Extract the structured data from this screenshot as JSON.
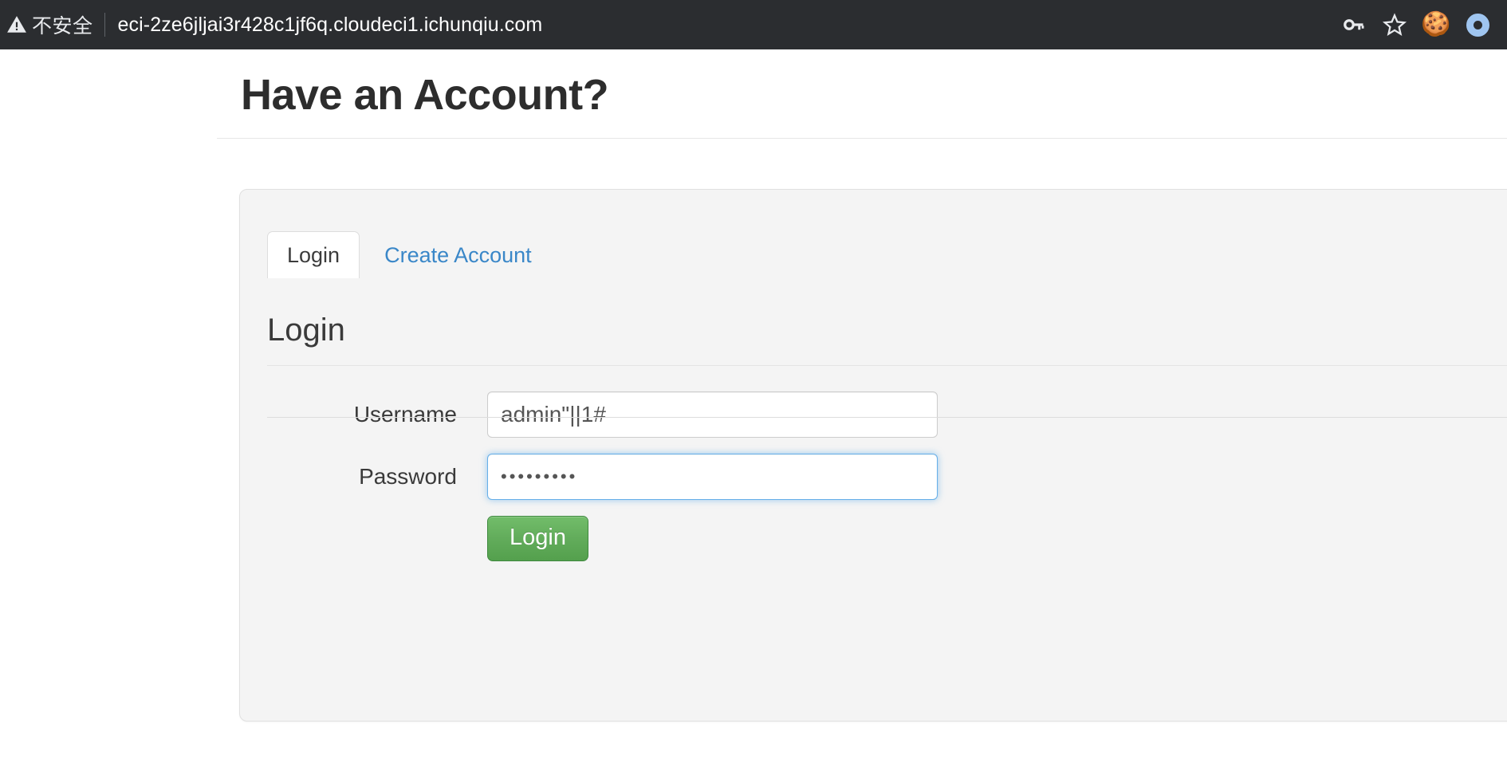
{
  "browser": {
    "security_warning": "不安全",
    "security_icon": "warning-triangle-icon",
    "url": "eci-2ze6jljai3r428c1jf6q.cloudeci1.ichunqiu.com",
    "toolbar_icons": [
      {
        "name": "password-key-icon",
        "glyph": "key"
      },
      {
        "name": "bookmark-star-icon",
        "glyph": "star"
      },
      {
        "name": "cookie-extension-icon",
        "glyph": "🍪"
      },
      {
        "name": "profile-avatar-icon",
        "glyph": "ring"
      }
    ],
    "colors": {
      "chrome_background": "#2b2d30",
      "url_text": "#ffffff",
      "avatar_ring": "#9fc5f0"
    }
  },
  "page": {
    "title": "Have an Account?",
    "tabs": [
      {
        "label": "Login",
        "active": true
      },
      {
        "label": "Create Account",
        "active": false
      }
    ],
    "panel": {
      "heading": "Login",
      "fields": [
        {
          "label": "Username",
          "value": "admin\"||1#",
          "placeholder": "",
          "type": "text",
          "focused": false
        },
        {
          "label": "Password",
          "value": "•••••••••",
          "placeholder": "",
          "type": "password",
          "focused": true,
          "char_count": 9
        }
      ],
      "submit_label": "Login"
    }
  },
  "colors": {
    "link": "#3a87c8",
    "panel_background": "#f4f4f4",
    "submit_green": "#62ac5b",
    "focus_blue": "#66afe9",
    "body_text": "#3a3a3a"
  }
}
